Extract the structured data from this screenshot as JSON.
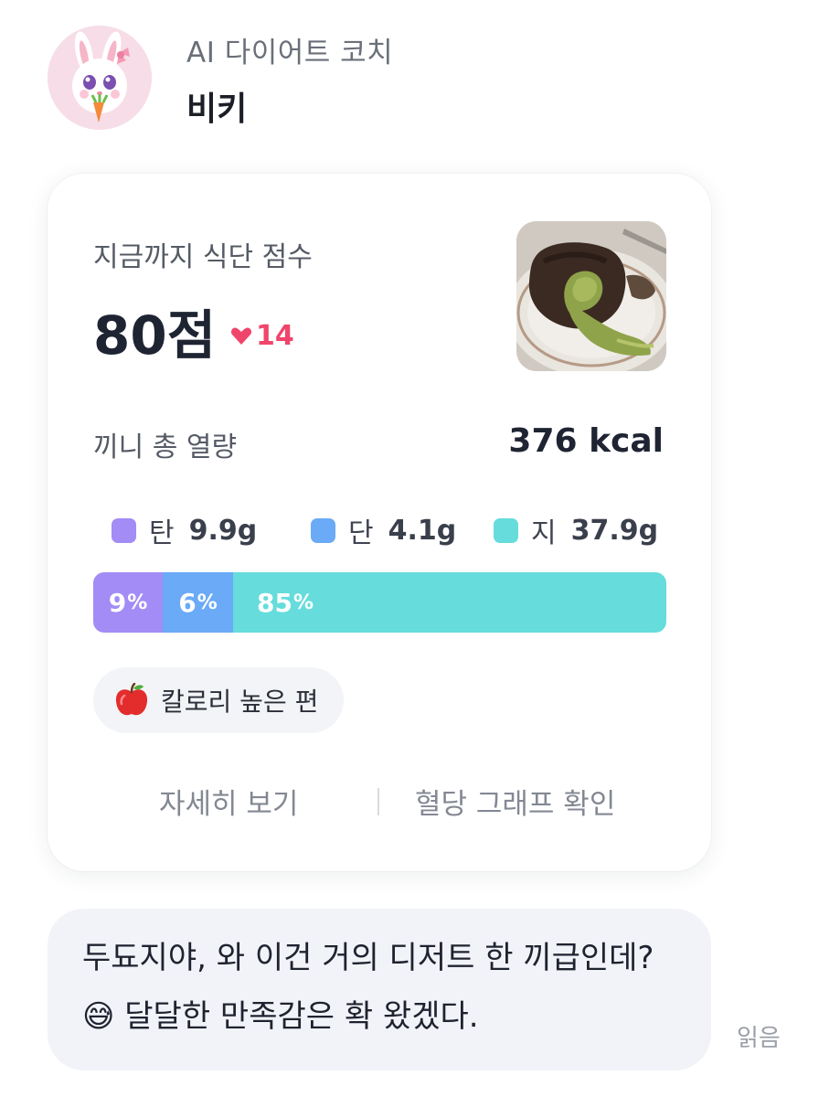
{
  "coach": {
    "role": "AI 다이어트 코치",
    "name": "비키"
  },
  "card": {
    "score_label": "지금까지 식단 점수",
    "score_value": "80점",
    "score_delta": "14",
    "score_delta_direction": "down",
    "kcal_label": "끼니 총 열량",
    "kcal_value": "376 kcal",
    "macros": [
      {
        "name": "탄",
        "amount": "9.9g",
        "color": "#a38cf5"
      },
      {
        "name": "단",
        "amount": "4.1g",
        "color": "#6aaaf6"
      },
      {
        "name": "지",
        "amount": "37.9g",
        "color": "#66dcdc"
      }
    ],
    "ratio_bar": [
      {
        "value": "9",
        "unit": "%",
        "percent": 9,
        "color": "#a38cf5"
      },
      {
        "value": "6",
        "unit": "%",
        "percent": 6,
        "color": "#6aaaf6"
      },
      {
        "value": "85",
        "unit": "%",
        "percent": 85,
        "color": "#66dcdc"
      }
    ],
    "tag": {
      "icon": "apple-icon",
      "label": "칼로리 높은 편"
    },
    "actions": {
      "detail": "자세히 보기",
      "glucose": "혈당 그래프 확인"
    }
  },
  "message": {
    "text_part1": "두됴지야, 와 이건 거의 디저트 한 끼급인데?",
    "emoji": "😅",
    "text_part2": "달달한 만족감은 확 왔겠다.",
    "status": "읽음"
  },
  "colors": {
    "accent_down": "#f0456b",
    "bubble_bg": "#f2f3f8"
  }
}
